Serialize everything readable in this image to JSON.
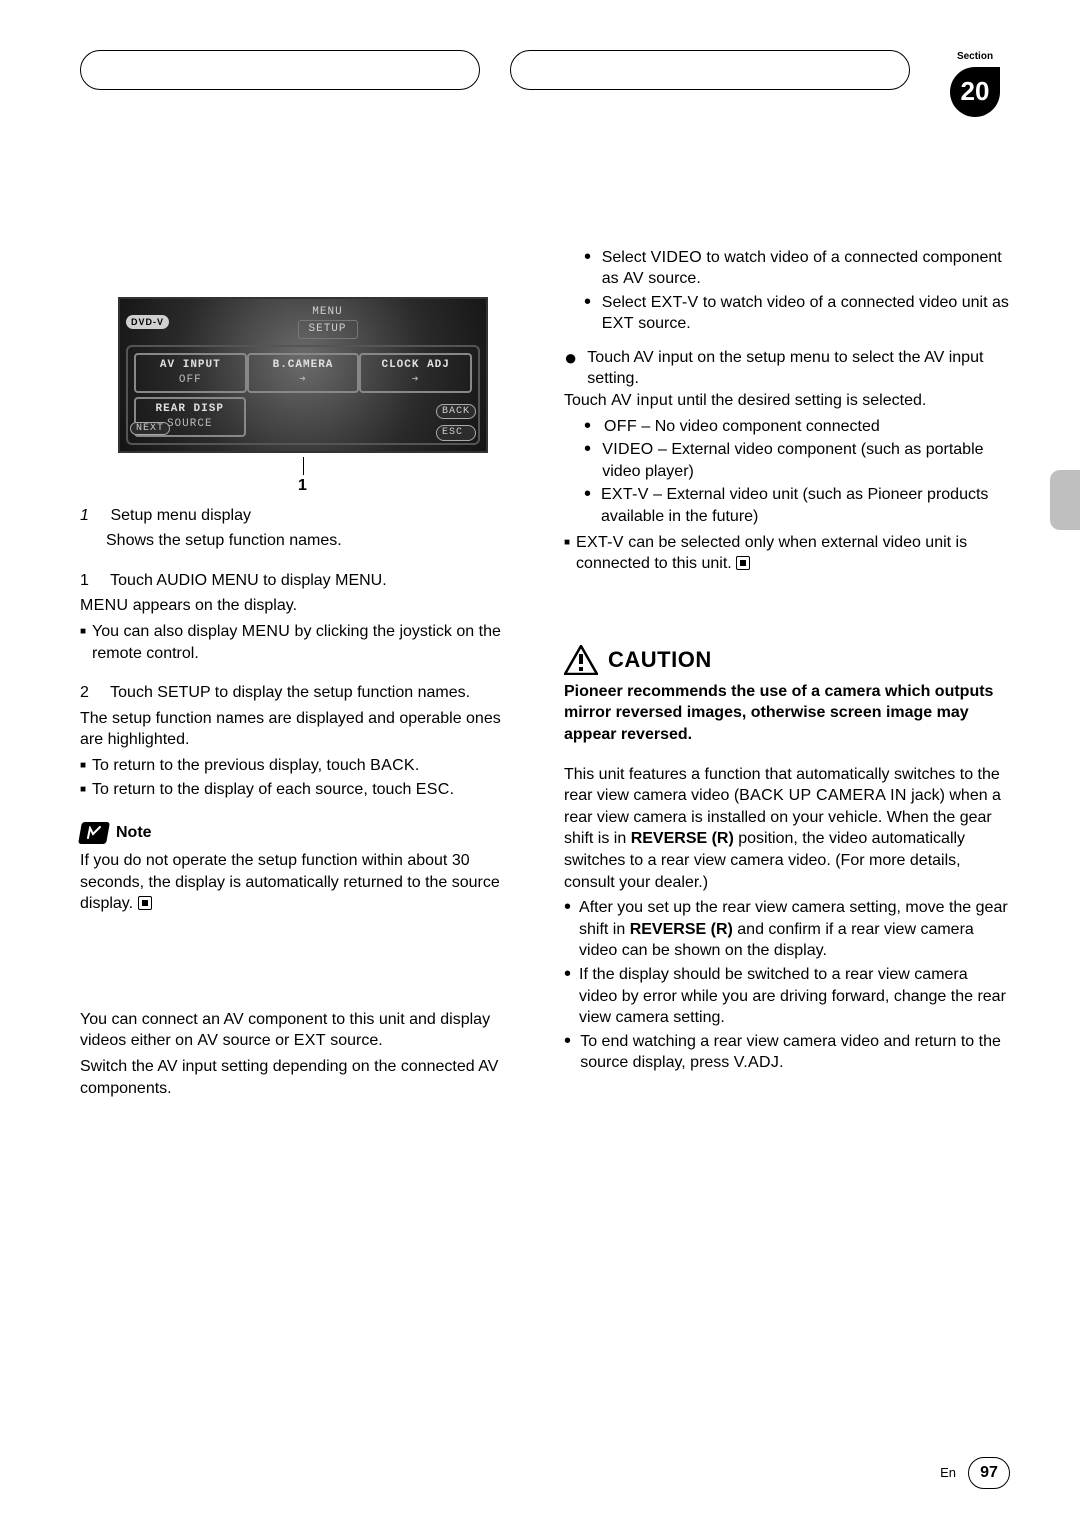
{
  "section": {
    "label": "Section",
    "number": "20"
  },
  "menu": {
    "dvd": "DVD-V",
    "title": "MENU",
    "tab": "SETUP",
    "cells": {
      "av_input_label": "AV INPUT",
      "av_input_val": "OFF",
      "bcamera_label": "B.CAMERA",
      "bcamera_val": "",
      "clock_label": "CLOCK ADJ",
      "clock_val": "",
      "rear_disp_label": "REAR DISP",
      "source_label": "SOURCE"
    },
    "btn_back": "BACK",
    "btn_esc": "ESC",
    "btn_next": "NEXT"
  },
  "leader_num": "1",
  "left": {
    "legend_num": "1",
    "legend_title": "Setup menu display",
    "legend_body": "Shows the setup function names.",
    "step1_num": "1",
    "step1_head": "Touch AUDIO MENU to display MENU.",
    "step1_body_a": "MENU",
    "step1_body_b": " appears on the display.",
    "step1_sub_a": "You can also display ",
    "step1_sub_b": "MENU",
    "step1_sub_c": " by clicking the joystick on the remote control.",
    "step2_num": "2",
    "step2_head": "Touch SETUP to display the setup function names.",
    "step2_body": "The setup function names are displayed and operable ones are highlighted.",
    "step2_sub1_a": "To return to the previous display, touch ",
    "step2_sub1_b": "BACK",
    "step2_sub1_c": ".",
    "step2_sub2_a": "To return to the display of each source, touch ",
    "step2_sub2_b": "ESC",
    "step2_sub2_c": ".",
    "note_label": "Note",
    "note_body": "If you do not operate the setup function within about 30 seconds, the display is automatically returned to the source display.",
    "av_intro_a": "You can connect an AV component to this unit and display videos either on ",
    "av_intro_b": "AV",
    "av_intro_c": " source or ",
    "av_intro_d": "EXT",
    "av_intro_e": " source.",
    "av_switch": "Switch the AV input setting depending on the connected AV components."
  },
  "right": {
    "r1a": "Select ",
    "r1b": "VIDEO",
    "r1c": " to watch video of a connected component as ",
    "r1d": "AV",
    "r1e": " source.",
    "r2a": "Select ",
    "r2b": "EXT-V",
    "r2c": " to watch video of a connected video unit as ",
    "r2d": "EXT",
    "r2e": " source.",
    "action_head": "Touch AV input on the setup menu to select the AV input setting.",
    "action_body_a": "Touch ",
    "action_body_b": "AV input",
    "action_body_c": " until the desired setting is selected.",
    "opt1a": "OFF",
    "opt1b": " – No video component connected",
    "opt2a": "VIDEO",
    "opt2b": " – External video component (such as portable video player)",
    "opt3a": "EXT-V",
    "opt3b": " – External video unit (such as Pioneer products available in the future)",
    "extv_note_a": "EXT-V",
    "extv_note_b": " can be selected only when external video unit is connected to this unit.",
    "caution_label": "CAUTION",
    "caution_bold": "Pioneer recommends the use of a camera which outputs mirror reversed images, otherwise screen image may appear reversed.",
    "cam_para_a": "This unit features a function that automatically switches to the rear view camera video (",
    "cam_para_b": "BACK UP CAMERA IN",
    "cam_para_c": " jack) when a rear view camera is installed on your vehicle. When the gear shift is in ",
    "cam_para_d": "REVERSE (R)",
    "cam_para_e": " position, the video automatically switches to a rear view camera video. (For more details, consult your dealer.)",
    "cam_li1_a": "After you set up the rear view camera setting, move the gear shift in ",
    "cam_li1_b": "REVERSE (R)",
    "cam_li1_c": " and confirm if a rear view camera video can be shown on the display.",
    "cam_li2": "If the display should be switched to a rear view camera video by error while you are driving forward, change the rear view camera setting.",
    "cam_li3_a": "To end watching a rear view camera video and return to the source display, press ",
    "cam_li3_b": "V.ADJ",
    "cam_li3_c": "."
  },
  "footer": {
    "lang": "En",
    "page": "97"
  }
}
